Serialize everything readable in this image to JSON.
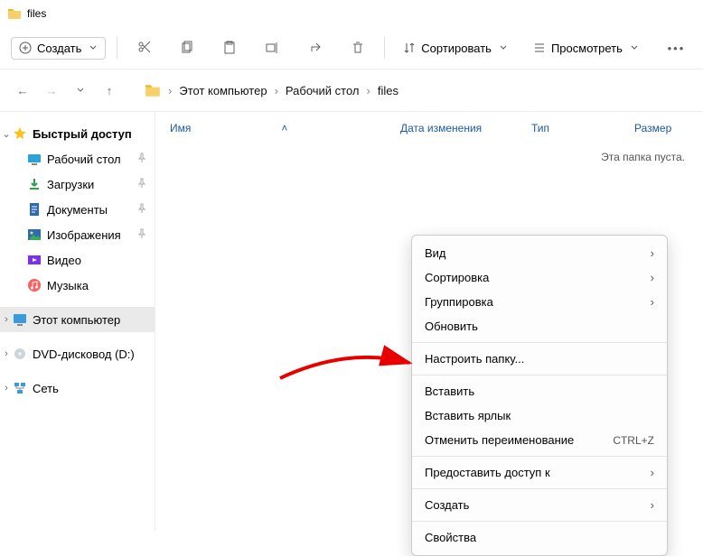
{
  "title": "files",
  "toolbar": {
    "create": "Создать",
    "sort": "Сортировать",
    "view": "Просмотреть"
  },
  "breadcrumb": [
    "Этот компьютер",
    "Рабочий стол",
    "files"
  ],
  "columns": {
    "name": "Имя",
    "date": "Дата изменения",
    "type": "Тип",
    "size": "Размер"
  },
  "empty": "Эта папка пуста.",
  "sidebar": {
    "quick": "Быстрый доступ",
    "items": [
      {
        "label": "Рабочий стол",
        "pinned": true,
        "icon": "desktop"
      },
      {
        "label": "Загрузки",
        "pinned": true,
        "icon": "download"
      },
      {
        "label": "Документы",
        "pinned": true,
        "icon": "doc"
      },
      {
        "label": "Изображения",
        "pinned": true,
        "icon": "image"
      },
      {
        "label": "Видео",
        "pinned": false,
        "icon": "video"
      },
      {
        "label": "Музыка",
        "pinned": false,
        "icon": "music"
      }
    ],
    "thispc": "Этот компьютер",
    "dvd": "DVD-дисковод (D:)",
    "network": "Сеть"
  },
  "context": [
    {
      "label": "Вид",
      "submenu": true
    },
    {
      "label": "Сортировка",
      "submenu": true
    },
    {
      "label": "Группировка",
      "submenu": true
    },
    {
      "label": "Обновить"
    },
    {
      "sep": true
    },
    {
      "label": "Настроить папку..."
    },
    {
      "sep": true
    },
    {
      "label": "Вставить"
    },
    {
      "label": "Вставить ярлык"
    },
    {
      "label": "Отменить переименование",
      "shortcut": "CTRL+Z"
    },
    {
      "sep": true
    },
    {
      "label": "Предоставить доступ к",
      "submenu": true
    },
    {
      "sep": true
    },
    {
      "label": "Создать",
      "submenu": true
    },
    {
      "sep": true
    },
    {
      "label": "Свойства"
    }
  ]
}
